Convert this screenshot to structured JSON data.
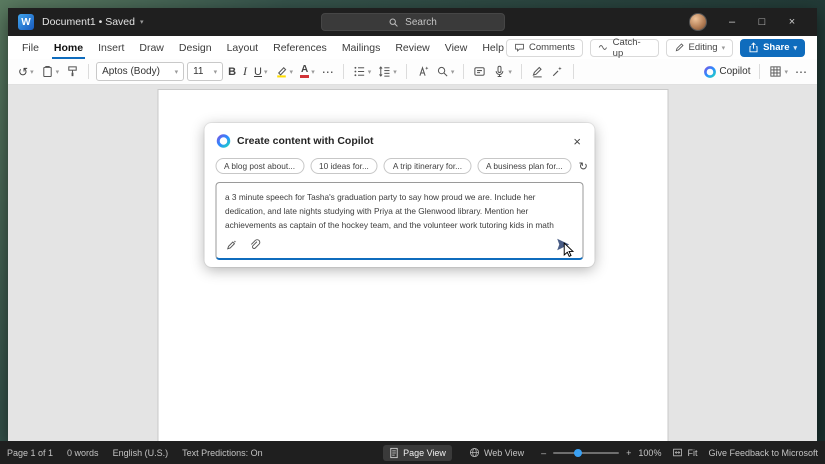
{
  "colors": {
    "accent": "#0f6cbd",
    "share_button": "#0f6cbd",
    "highlight_yellow": "#ffdd00",
    "font_color_red": "#d13438"
  },
  "icons": {
    "caret": "▾",
    "more": "⋯",
    "undo": "↺",
    "refresh": "↻",
    "minimize": "–",
    "maximize": "□",
    "close": "×",
    "dialog_close": "×",
    "zoom_out": "–",
    "zoom_in": "+"
  },
  "titlebar": {
    "doc_title": "Document1 • Saved",
    "search": "Search"
  },
  "menubar": {
    "tabs": [
      "File",
      "Home",
      "Insert",
      "Draw",
      "Design",
      "Layout",
      "References",
      "Mailings",
      "Review",
      "View",
      "Help"
    ],
    "active_tab": "Home",
    "comments": "Comments",
    "catchup": "Catch-up",
    "editing": "Editing",
    "share": "Share"
  },
  "toolbar": {
    "font_name": "Aptos (Body)",
    "font_size": "11",
    "bold": "B",
    "italic": "I",
    "underline": "U",
    "font_color_letter": "A",
    "copilot": "Copilot"
  },
  "copilot_dialog": {
    "title": "Create content with Copilot",
    "chips": [
      "A blog post about...",
      "10 ideas for...",
      "A trip itinerary for...",
      "A business plan for..."
    ],
    "prompt": "a 3 minute speech for Tasha's graduation party to say how proud we are. Include her dedication, and late nights studying with Priya at the Glenwood library. Mention her achievements as captain of the hockey team, and the volunteer work tutoring kids in math"
  },
  "statusbar": {
    "page": "Page 1 of 1",
    "words": "0 words",
    "language": "English (U.S.)",
    "predictions": "Text Predictions: On",
    "page_view": "Page View",
    "web_view": "Web View",
    "zoom": "100%",
    "fit": "Fit",
    "feedback": "Give Feedback to Microsoft"
  }
}
